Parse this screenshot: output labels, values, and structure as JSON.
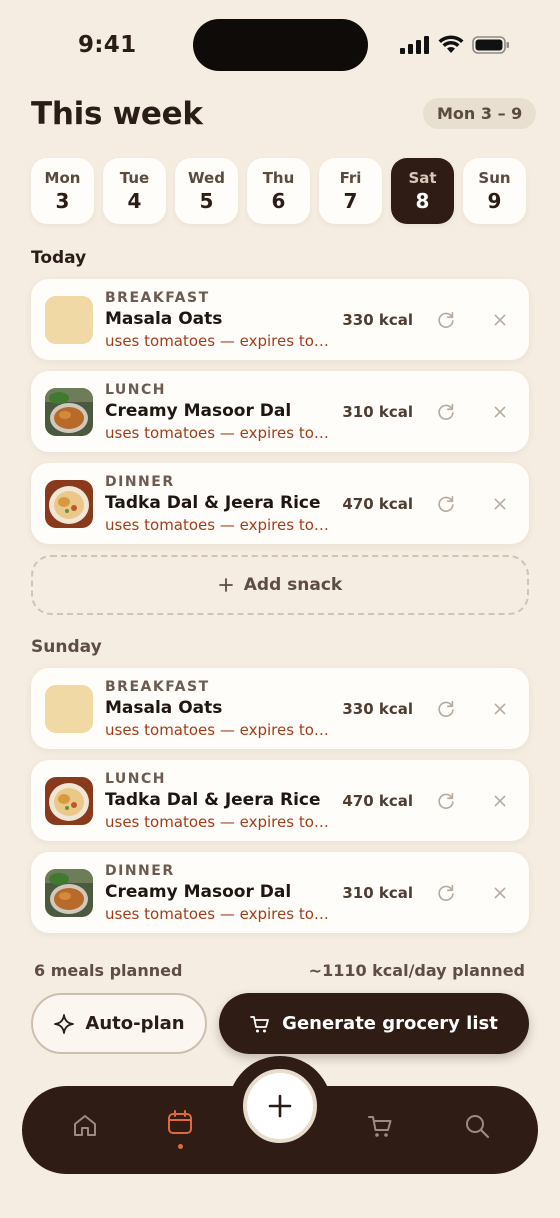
{
  "status": {
    "time": "9:41"
  },
  "header": {
    "title": "This week",
    "range": "Mon 3 – 9"
  },
  "days": [
    {
      "name": "Mon",
      "num": "3",
      "active": false
    },
    {
      "name": "Tue",
      "num": "4",
      "active": false
    },
    {
      "name": "Wed",
      "num": "5",
      "active": false
    },
    {
      "name": "Thu",
      "num": "6",
      "active": false
    },
    {
      "name": "Fri",
      "num": "7",
      "active": false
    },
    {
      "name": "Sat",
      "num": "8",
      "active": true
    },
    {
      "name": "Sun",
      "num": "9",
      "active": false
    }
  ],
  "today": {
    "title": "Today",
    "meals": [
      {
        "type": "BREAKFAST",
        "name": "Masala Oats",
        "note": "uses tomatoes — expires to…",
        "kcal": "330 kcal",
        "thumb": "oats"
      },
      {
        "type": "LUNCH",
        "name": "Creamy Masoor Dal",
        "note": "uses tomatoes — expires tom…",
        "kcal": "310 kcal",
        "thumb": "dal"
      },
      {
        "type": "DINNER",
        "name": "Tadka Dal & Jeera Rice",
        "note": "uses tomatoes — expires to…",
        "kcal": "470 kcal",
        "thumb": "rice"
      }
    ],
    "add_snack": "Add snack"
  },
  "sunday": {
    "title": "Sunday",
    "meals": [
      {
        "type": "BREAKFAST",
        "name": "Masala Oats",
        "note": "uses tomatoes — expires to…",
        "kcal": "330 kcal",
        "thumb": "oats"
      },
      {
        "type": "LUNCH",
        "name": "Tadka Dal & Jeera Rice",
        "note": "uses tomatoes — expires to…",
        "kcal": "470 kcal",
        "thumb": "rice"
      },
      {
        "type": "DINNER",
        "name": "Creamy Masoor Dal",
        "note": "uses tomatoes — expires tom…",
        "kcal": "310 kcal",
        "thumb": "dal"
      }
    ]
  },
  "summary": {
    "meals_planned": "6 meals planned",
    "kcal_planned": "~1110 kcal/day planned"
  },
  "actions": {
    "autoplan": "Auto-plan",
    "grocery": "Generate grocery list"
  },
  "tabs": [
    {
      "icon": "home-icon",
      "active": false
    },
    {
      "icon": "calendar-icon",
      "active": true
    },
    {
      "icon": "plus-icon",
      "active": false
    },
    {
      "icon": "cart-icon",
      "active": false
    },
    {
      "icon": "search-icon",
      "active": false
    }
  ],
  "colors": {
    "background": "#f5ede2",
    "dark": "#2e1c15",
    "accent": "#e06a3b",
    "warning_text": "#a23d1b"
  }
}
